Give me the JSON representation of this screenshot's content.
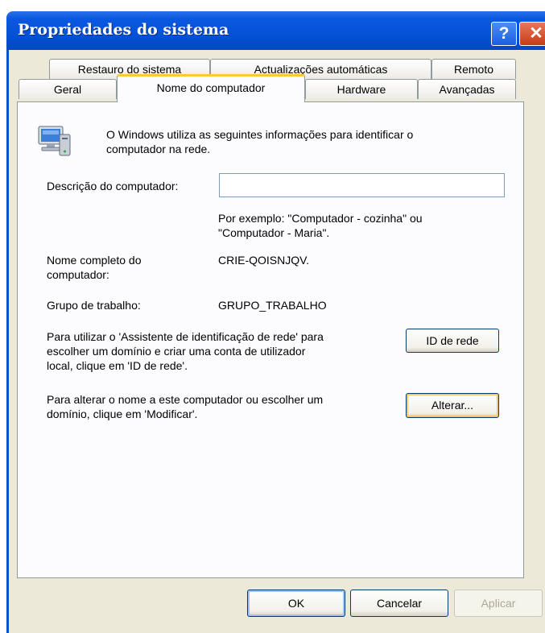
{
  "window": {
    "title": "Propriedades do sistema",
    "help_label": "?",
    "close_label": "✕"
  },
  "tabs": {
    "row1": [
      "Restauro do sistema",
      "Actualizações automáticas",
      "Remoto"
    ],
    "row2": [
      "Geral",
      "Nome do computador",
      "Hardware",
      "Avançadas"
    ],
    "selected": "Nome do computador"
  },
  "intro": {
    "icon": "computer-network-icon",
    "line1": "O Windows utiliza as seguintes informações para identificar o",
    "line2": "computador na rede."
  },
  "description": {
    "label": "Descrição do computador:",
    "value": "",
    "example_line1": "Por exemplo: \"Computador - cozinha\" ou",
    "example_line2": "\"Computador - Maria\"."
  },
  "full_name": {
    "label_line1": "Nome completo do",
    "label_line2": "computador:",
    "value": "CRIE-QOISNJQV."
  },
  "workgroup": {
    "label": "Grupo de trabalho:",
    "value": "GRUPO_TRABALHO"
  },
  "network_id": {
    "text_line1": "Para utilizar o 'Assistente de identificação de rede' para",
    "text_line2": "escolher um domínio e criar uma conta de utilizador",
    "text_line3": "local, clique em 'ID de rede'.",
    "button": "ID de rede"
  },
  "rename": {
    "text_line1": "Para alterar o nome a este computador ou escolher um",
    "text_line2": "domínio, clique em 'Modificar'.",
    "button": "Alterar..."
  },
  "footer": {
    "ok": "OK",
    "cancel": "Cancelar",
    "apply": "Aplicar"
  },
  "colors": {
    "titlebar": "#0452d6",
    "face": "#ece9d8",
    "selected_tab_accent": "#ffc83c"
  }
}
